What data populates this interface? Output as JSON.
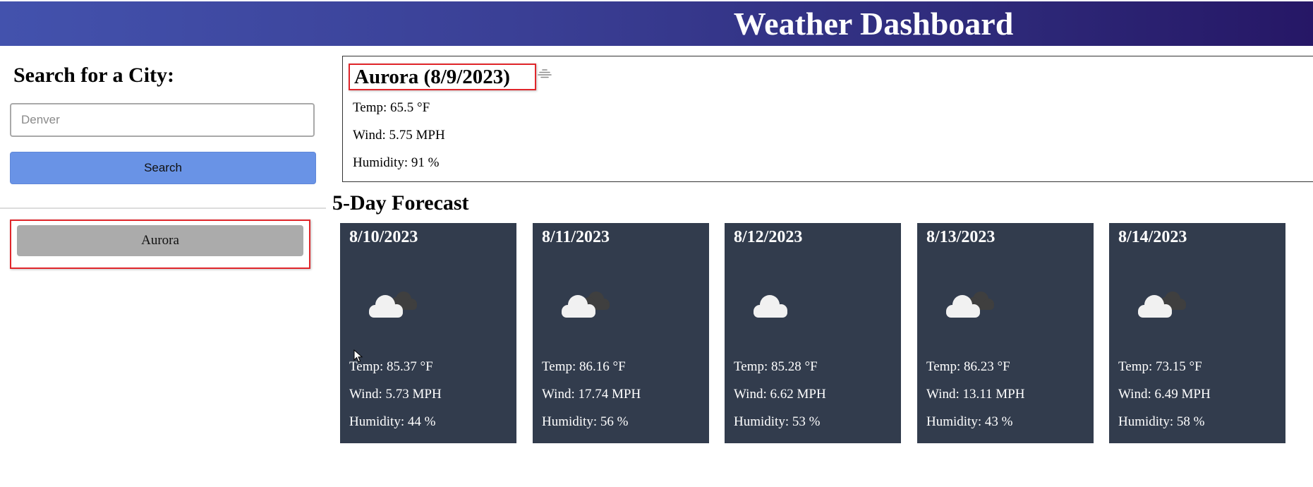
{
  "header": {
    "title": "Weather Dashboard"
  },
  "sidebar": {
    "heading": "Search for a City:",
    "search_input": {
      "placeholder": "Denver",
      "value": ""
    },
    "search_button_label": "Search",
    "history": [
      {
        "label": "Aurora"
      }
    ]
  },
  "current": {
    "title": "Aurora (8/9/2023)",
    "icon": "haze-icon",
    "temp": "Temp: 65.5 °F",
    "wind": "Wind: 5.75 MPH",
    "humidity": "Humidity: 91 %"
  },
  "forecast": {
    "heading": "5-Day Forecast",
    "days": [
      {
        "date": "8/10/2023",
        "icon": "broken-clouds-icon",
        "temp": "Temp: 85.37 °F",
        "wind": "Wind: 5.73 MPH",
        "humidity": "Humidity: 44 %"
      },
      {
        "date": "8/11/2023",
        "icon": "broken-clouds-icon",
        "temp": "Temp: 86.16 °F",
        "wind": "Wind: 17.74 MPH",
        "humidity": "Humidity: 56 %"
      },
      {
        "date": "8/12/2023",
        "icon": "cloud-icon",
        "temp": "Temp: 85.28 °F",
        "wind": "Wind: 6.62 MPH",
        "humidity": "Humidity: 53 %"
      },
      {
        "date": "8/13/2023",
        "icon": "broken-clouds-icon",
        "temp": "Temp: 86.23 °F",
        "wind": "Wind: 13.11 MPH",
        "humidity": "Humidity: 43 %"
      },
      {
        "date": "8/14/2023",
        "icon": "broken-clouds-icon",
        "temp": "Temp: 73.15 °F",
        "wind": "Wind: 6.49 MPH",
        "humidity": "Humidity: 58 %"
      }
    ]
  },
  "colors": {
    "header_gradient_start": "#4352ad",
    "header_gradient_end": "#261766",
    "search_button": "#6993e6",
    "history_button": "#ababab",
    "forecast_card": "#323c4d",
    "highlight_border": "#e0262b"
  }
}
